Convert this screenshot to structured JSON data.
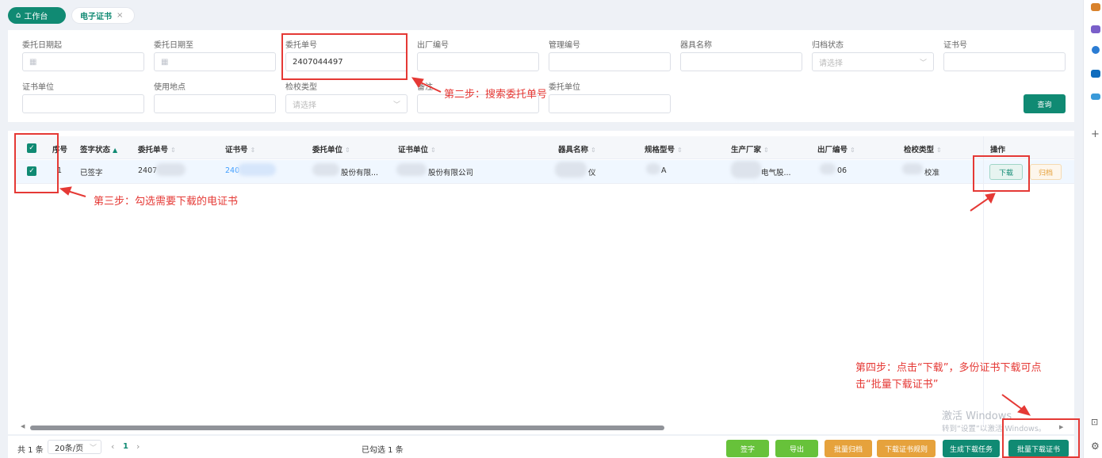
{
  "tabs": [
    {
      "label": "工作台",
      "icon": "home-icon"
    },
    {
      "label": "电子证书",
      "close": "×"
    }
  ],
  "filters": {
    "row1": [
      {
        "label": "委托日期起",
        "value": "",
        "icon": "calendar-icon"
      },
      {
        "label": "委托日期至",
        "value": "",
        "icon": "calendar-icon"
      },
      {
        "label": "委托单号",
        "value": "2407044497"
      },
      {
        "label": "出厂编号",
        "value": ""
      },
      {
        "label": "管理编号",
        "value": ""
      },
      {
        "label": "器具名称",
        "value": ""
      },
      {
        "label": "归档状态",
        "placeholder": "请选择"
      },
      {
        "label": "证书号",
        "value": ""
      }
    ],
    "row2": [
      {
        "label": "证书单位",
        "value": ""
      },
      {
        "label": "使用地点",
        "value": ""
      },
      {
        "label": "检校类型",
        "placeholder": "请选择"
      },
      {
        "label": "备注",
        "value": ""
      },
      {
        "label": "委托单位",
        "value": ""
      }
    ],
    "query_label": "查询"
  },
  "table": {
    "headers": [
      "序号",
      "签字状态",
      "委托单号",
      "证书号",
      "委托单位",
      "证书单位",
      "器具名称",
      "规格型号",
      "生产厂家",
      "出厂编号",
      "检校类型",
      "操作"
    ],
    "row": {
      "index": "1",
      "sign_status": "已签字",
      "order_no": "2407",
      "cert_no": "240",
      "client_unit": "股份有限...",
      "cert_unit": "股份有限公司",
      "instrument": "仪",
      "model": "A",
      "manufacturer": "电气股...",
      "serial": "06",
      "check_type": "校准",
      "download_label": "下载",
      "archive_label": "归档"
    }
  },
  "annotations": {
    "step2": "第二步：搜索委托单号",
    "step3": "第三步：勾选需要下载的电证书",
    "step4_line1": "第四步：点击“下载”，多份证书下载可点",
    "step4_line2": "击“批量下载证书”"
  },
  "watermark": {
    "line1": "激活 Windows",
    "line2": "转到“设置”以激活 Windows。"
  },
  "footer": {
    "total": "共 1 条",
    "page_size": "20条/页",
    "prev": "‹",
    "page": "1",
    "next": "›",
    "selected": "已勾选 1 条",
    "buttons": [
      "签字",
      "导出",
      "批量归档",
      "下载证书规则",
      "生成下载任务",
      "批量下载证书"
    ]
  },
  "colors": {
    "primary": "#108a73",
    "sign": "#67c23a",
    "archive": "#e6a23c",
    "annotation": "#e53935"
  }
}
